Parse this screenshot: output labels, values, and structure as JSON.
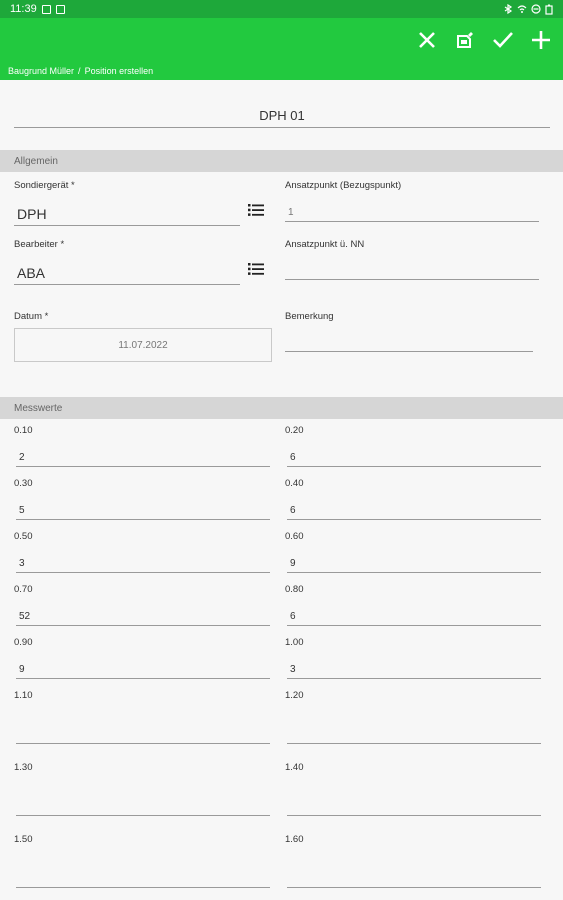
{
  "status": {
    "time": "11:39"
  },
  "header": {
    "breadcrumb": [
      "Baugrund Müller",
      "/",
      "Position erstellen"
    ],
    "actions": [
      "close-icon",
      "save-icon",
      "check-icon",
      "add-icon"
    ]
  },
  "form": {
    "title_value": "DPH 01",
    "section_general": "Allgemein",
    "sondergeraet": {
      "label": "Sondiergerät *",
      "value": "DPH"
    },
    "bearbeiter": {
      "label": "Bearbeiter *",
      "value": "ABA"
    },
    "datum": {
      "label": "Datum *",
      "value": "11.07.2022"
    },
    "ansatzpunkt": {
      "label": "Ansatzpunkt (Bezugspunkt)",
      "value": "1"
    },
    "ansatzpunkt_nn": {
      "label": "Ansatzpunkt ü. NN",
      "value": ""
    },
    "bemerkung": {
      "label": "Bemerkung",
      "value": ""
    },
    "section_measure": "Messwerte",
    "measurements": [
      {
        "depth": "0.10",
        "value": "2"
      },
      {
        "depth": "0.20",
        "value": "6"
      },
      {
        "depth": "0.30",
        "value": "5"
      },
      {
        "depth": "0.40",
        "value": "6"
      },
      {
        "depth": "0.50",
        "value": "3"
      },
      {
        "depth": "0.60",
        "value": "9"
      },
      {
        "depth": "0.70",
        "value": "52"
      },
      {
        "depth": "0.80",
        "value": "6"
      },
      {
        "depth": "0.90",
        "value": "9"
      },
      {
        "depth": "1.00",
        "value": "3"
      },
      {
        "depth": "1.10",
        "value": ""
      },
      {
        "depth": "1.20",
        "value": ""
      },
      {
        "depth": "1.30",
        "value": ""
      },
      {
        "depth": "1.40",
        "value": ""
      },
      {
        "depth": "1.50",
        "value": ""
      },
      {
        "depth": "1.60",
        "value": ""
      }
    ]
  }
}
